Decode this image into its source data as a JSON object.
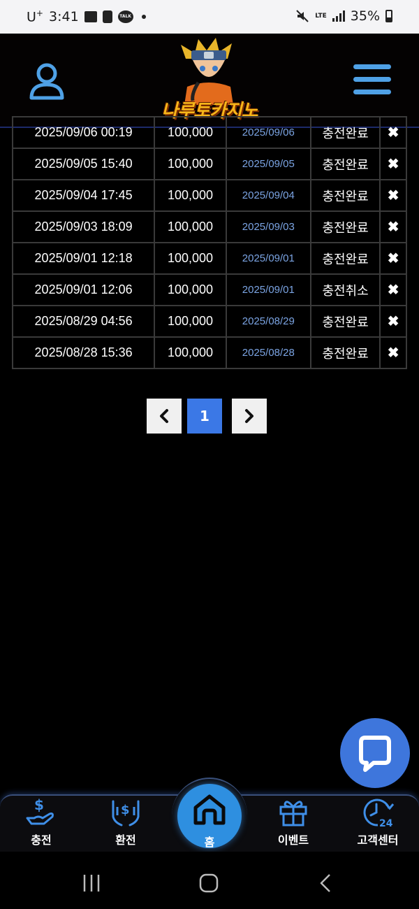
{
  "status_bar": {
    "carrier": "U",
    "carrier_sup": "+",
    "time": "3:41",
    "talk_icon_text": "TALK",
    "network": "LTE",
    "battery": "35%"
  },
  "header": {
    "logo_text": "나루토카지노"
  },
  "history": {
    "rows": [
      {
        "date": "2025/09/06 00:19",
        "amount": "100,000",
        "processed": "2025/09/06",
        "status": "충전완료",
        "delete": "✖"
      },
      {
        "date": "2025/09/05 15:40",
        "amount": "100,000",
        "processed": "2025/09/05",
        "status": "충전완료",
        "delete": "✖"
      },
      {
        "date": "2025/09/04 17:45",
        "amount": "100,000",
        "processed": "2025/09/04",
        "status": "충전완료",
        "delete": "✖"
      },
      {
        "date": "2025/09/03 18:09",
        "amount": "100,000",
        "processed": "2025/09/03",
        "status": "충전완료",
        "delete": "✖"
      },
      {
        "date": "2025/09/01 12:18",
        "amount": "100,000",
        "processed": "2025/09/01",
        "status": "충전완료",
        "delete": "✖"
      },
      {
        "date": "2025/09/01 12:06",
        "amount": "100,000",
        "processed": "2025/09/01",
        "status": "충전취소",
        "delete": "✖"
      },
      {
        "date": "2025/08/29 04:56",
        "amount": "100,000",
        "processed": "2025/08/29",
        "status": "충전완료",
        "delete": "✖"
      },
      {
        "date": "2025/08/28 15:36",
        "amount": "100,000",
        "processed": "2025/08/28",
        "status": "충전완료",
        "delete": "✖"
      }
    ]
  },
  "pagination": {
    "prev": "‹",
    "current": "1",
    "next": "›"
  },
  "bottom_nav": {
    "deposit": "충전",
    "withdraw": "환전",
    "home": "홈",
    "event": "이벤트",
    "support": "고객센터"
  },
  "colors": {
    "accent_blue": "#3b78e6",
    "nav_icon_blue": "#3f8fe8",
    "processed_date": "#7ba4e3",
    "logo_gold": "#f7b61a"
  },
  "icons": {
    "user": "user-icon",
    "menu": "menu-icon",
    "chat": "chat-icon",
    "deposit": "hand-dollar-icon",
    "withdraw": "hands-dollar-icon",
    "home": "home-icon",
    "event": "gift-icon",
    "support": "clock-24-icon"
  }
}
